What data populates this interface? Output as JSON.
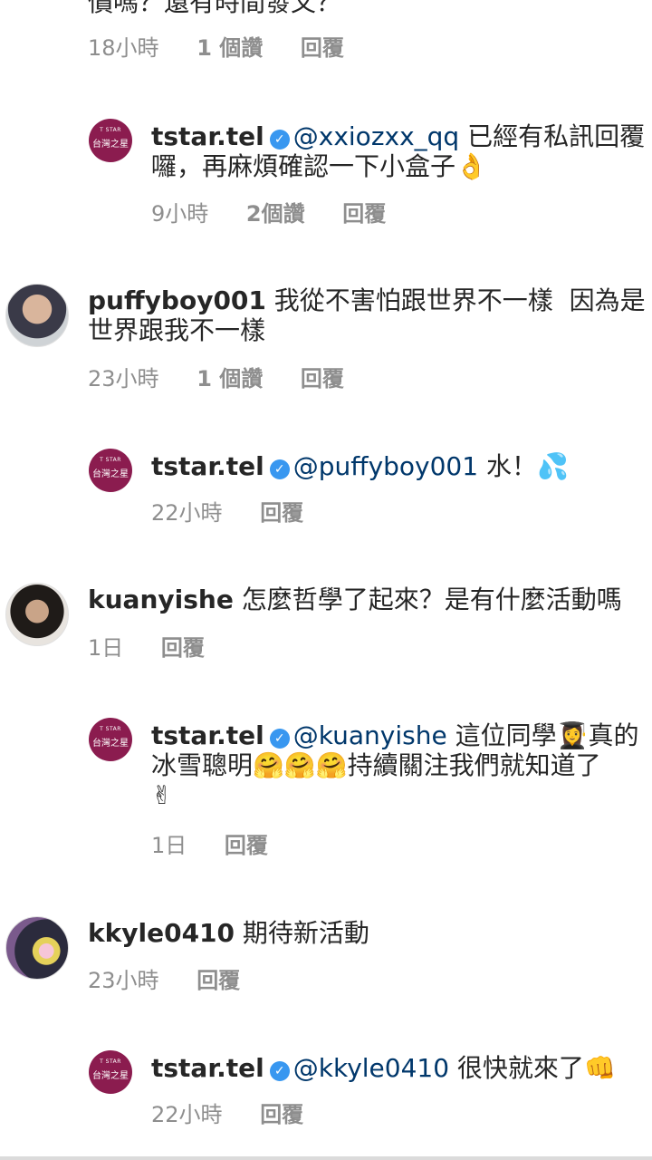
{
  "top_fragment": {
    "text": "價嗎？還有時間發文？"
  },
  "threads": [
    {
      "meta": {
        "time": "18小時",
        "likes": "1 個讚",
        "reply": "回覆"
      }
    },
    {
      "reply": {
        "username": "tstar.tel",
        "mention": "@xxiozxx_qq",
        "line1_rest": " 已經有私訊回覆",
        "line2": "囉，再麻煩確認一下小盒子",
        "emoji1": "👌",
        "meta": {
          "time": "9小時",
          "likes": "2個讚",
          "reply": "回覆"
        }
      }
    },
    {
      "comment": {
        "username": "puffyboy001",
        "line1_rest": " 我從不害怕跟世界不一樣  因為是",
        "line2": "世界跟我不一樣",
        "meta": {
          "time": "23小時",
          "likes": "1 個讚",
          "reply": "回覆"
        }
      },
      "reply": {
        "username": "tstar.tel",
        "mention": "@puffyboy001",
        "line1_rest": " 水！",
        "emoji1": "💦",
        "meta": {
          "time": "22小時",
          "reply": "回覆"
        }
      }
    },
    {
      "comment": {
        "username": "kuanyishe",
        "line1_rest": " 怎麼哲學了起來？是有什麼活動嗎",
        "meta": {
          "time": "1日",
          "reply": "回覆"
        }
      },
      "reply": {
        "username": "tstar.tel",
        "mention": "@kuanyishe",
        "line1_rest": " 這位同學",
        "emoji_grad": "👩‍🎓",
        "line1_end": "真的",
        "line2_pre": "冰雪聰明",
        "emoji_hug": "🤗🤗🤗",
        "line2_post": "持續關注我們就知道了",
        "emoji_peace": "✌",
        "meta": {
          "time": "1日",
          "reply": "回覆"
        }
      }
    },
    {
      "comment": {
        "username": "kkyle0410",
        "line1_rest": " 期待新活動",
        "meta": {
          "time": "23小時",
          "reply": "回覆"
        }
      },
      "reply": {
        "username": "tstar.tel",
        "mention": "@kkyle0410",
        "line1_rest": " 很快就來了",
        "emoji1": "👊",
        "meta": {
          "time": "22小時",
          "reply": "回覆"
        }
      }
    }
  ],
  "brand_logo": {
    "top": "T STAR",
    "main": "台灣之星"
  },
  "colors": {
    "brand": "#8b1c4f",
    "verified": "#3897f0",
    "mention": "#00376b",
    "meta": "#8e8e8e"
  }
}
